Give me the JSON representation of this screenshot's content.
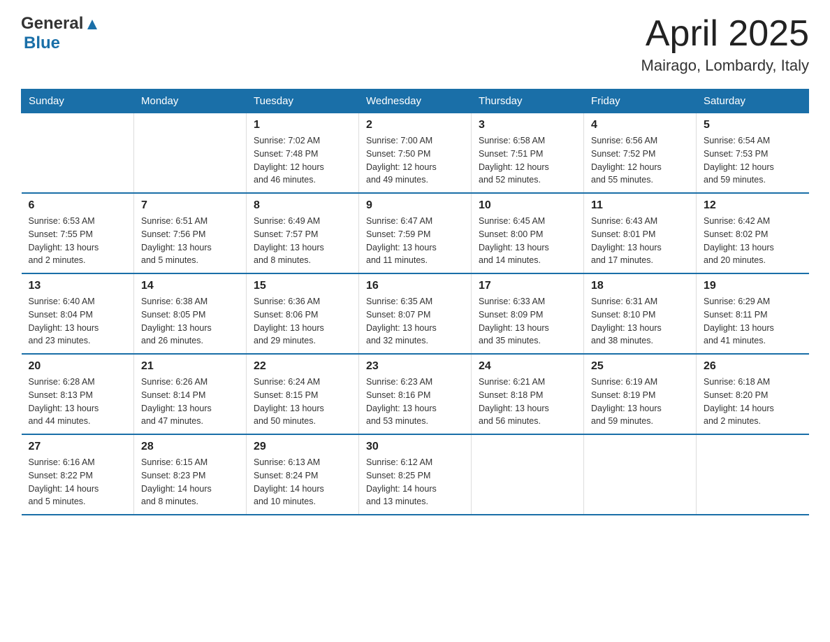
{
  "logo": {
    "text_general": "General",
    "arrow_symbol": "▲",
    "text_blue": "Blue"
  },
  "header": {
    "month": "April 2025",
    "location": "Mairago, Lombardy, Italy"
  },
  "weekdays": [
    "Sunday",
    "Monday",
    "Tuesday",
    "Wednesday",
    "Thursday",
    "Friday",
    "Saturday"
  ],
  "weeks": [
    [
      {
        "day": "",
        "info": ""
      },
      {
        "day": "",
        "info": ""
      },
      {
        "day": "1",
        "info": "Sunrise: 7:02 AM\nSunset: 7:48 PM\nDaylight: 12 hours\nand 46 minutes."
      },
      {
        "day": "2",
        "info": "Sunrise: 7:00 AM\nSunset: 7:50 PM\nDaylight: 12 hours\nand 49 minutes."
      },
      {
        "day": "3",
        "info": "Sunrise: 6:58 AM\nSunset: 7:51 PM\nDaylight: 12 hours\nand 52 minutes."
      },
      {
        "day": "4",
        "info": "Sunrise: 6:56 AM\nSunset: 7:52 PM\nDaylight: 12 hours\nand 55 minutes."
      },
      {
        "day": "5",
        "info": "Sunrise: 6:54 AM\nSunset: 7:53 PM\nDaylight: 12 hours\nand 59 minutes."
      }
    ],
    [
      {
        "day": "6",
        "info": "Sunrise: 6:53 AM\nSunset: 7:55 PM\nDaylight: 13 hours\nand 2 minutes."
      },
      {
        "day": "7",
        "info": "Sunrise: 6:51 AM\nSunset: 7:56 PM\nDaylight: 13 hours\nand 5 minutes."
      },
      {
        "day": "8",
        "info": "Sunrise: 6:49 AM\nSunset: 7:57 PM\nDaylight: 13 hours\nand 8 minutes."
      },
      {
        "day": "9",
        "info": "Sunrise: 6:47 AM\nSunset: 7:59 PM\nDaylight: 13 hours\nand 11 minutes."
      },
      {
        "day": "10",
        "info": "Sunrise: 6:45 AM\nSunset: 8:00 PM\nDaylight: 13 hours\nand 14 minutes."
      },
      {
        "day": "11",
        "info": "Sunrise: 6:43 AM\nSunset: 8:01 PM\nDaylight: 13 hours\nand 17 minutes."
      },
      {
        "day": "12",
        "info": "Sunrise: 6:42 AM\nSunset: 8:02 PM\nDaylight: 13 hours\nand 20 minutes."
      }
    ],
    [
      {
        "day": "13",
        "info": "Sunrise: 6:40 AM\nSunset: 8:04 PM\nDaylight: 13 hours\nand 23 minutes."
      },
      {
        "day": "14",
        "info": "Sunrise: 6:38 AM\nSunset: 8:05 PM\nDaylight: 13 hours\nand 26 minutes."
      },
      {
        "day": "15",
        "info": "Sunrise: 6:36 AM\nSunset: 8:06 PM\nDaylight: 13 hours\nand 29 minutes."
      },
      {
        "day": "16",
        "info": "Sunrise: 6:35 AM\nSunset: 8:07 PM\nDaylight: 13 hours\nand 32 minutes."
      },
      {
        "day": "17",
        "info": "Sunrise: 6:33 AM\nSunset: 8:09 PM\nDaylight: 13 hours\nand 35 minutes."
      },
      {
        "day": "18",
        "info": "Sunrise: 6:31 AM\nSunset: 8:10 PM\nDaylight: 13 hours\nand 38 minutes."
      },
      {
        "day": "19",
        "info": "Sunrise: 6:29 AM\nSunset: 8:11 PM\nDaylight: 13 hours\nand 41 minutes."
      }
    ],
    [
      {
        "day": "20",
        "info": "Sunrise: 6:28 AM\nSunset: 8:13 PM\nDaylight: 13 hours\nand 44 minutes."
      },
      {
        "day": "21",
        "info": "Sunrise: 6:26 AM\nSunset: 8:14 PM\nDaylight: 13 hours\nand 47 minutes."
      },
      {
        "day": "22",
        "info": "Sunrise: 6:24 AM\nSunset: 8:15 PM\nDaylight: 13 hours\nand 50 minutes."
      },
      {
        "day": "23",
        "info": "Sunrise: 6:23 AM\nSunset: 8:16 PM\nDaylight: 13 hours\nand 53 minutes."
      },
      {
        "day": "24",
        "info": "Sunrise: 6:21 AM\nSunset: 8:18 PM\nDaylight: 13 hours\nand 56 minutes."
      },
      {
        "day": "25",
        "info": "Sunrise: 6:19 AM\nSunset: 8:19 PM\nDaylight: 13 hours\nand 59 minutes."
      },
      {
        "day": "26",
        "info": "Sunrise: 6:18 AM\nSunset: 8:20 PM\nDaylight: 14 hours\nand 2 minutes."
      }
    ],
    [
      {
        "day": "27",
        "info": "Sunrise: 6:16 AM\nSunset: 8:22 PM\nDaylight: 14 hours\nand 5 minutes."
      },
      {
        "day": "28",
        "info": "Sunrise: 6:15 AM\nSunset: 8:23 PM\nDaylight: 14 hours\nand 8 minutes."
      },
      {
        "day": "29",
        "info": "Sunrise: 6:13 AM\nSunset: 8:24 PM\nDaylight: 14 hours\nand 10 minutes."
      },
      {
        "day": "30",
        "info": "Sunrise: 6:12 AM\nSunset: 8:25 PM\nDaylight: 14 hours\nand 13 minutes."
      },
      {
        "day": "",
        "info": ""
      },
      {
        "day": "",
        "info": ""
      },
      {
        "day": "",
        "info": ""
      }
    ]
  ]
}
